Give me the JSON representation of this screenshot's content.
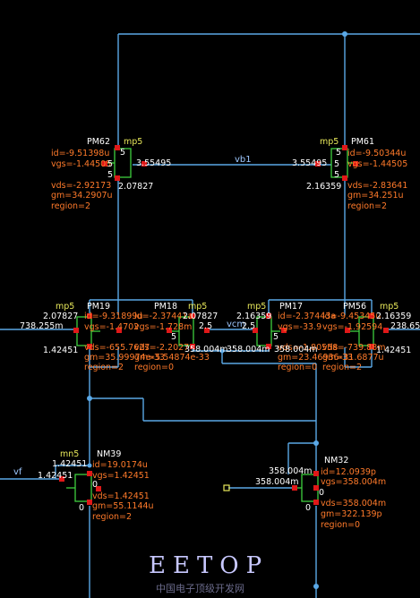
{
  "colors": {
    "background": "#000000",
    "wire": "#5aa8e6",
    "component": "#3ecf3e",
    "pin": "#e01818",
    "annotation": "#ff7a2a",
    "label": "#ffffff",
    "model": "#e8e85a"
  },
  "nets": {
    "vb1": "vb1",
    "vcm": "vcm",
    "vf": "vf"
  },
  "devices": [
    {
      "id": "PM62",
      "name": "PM62",
      "model": "mp5",
      "id_val": "id=-9.51398u",
      "vgs": "vgs=-1.44505",
      "vds": "vds=-2.92173",
      "gm": "gm=34.2907u",
      "region": "region=2",
      "pins": [
        "5",
        "5",
        "5",
        "3.55495",
        "2.07827"
      ]
    },
    {
      "id": "PM61",
      "name": "PM61",
      "model": "mp5",
      "id_val": "id=-9.50344u",
      "vgs": "vgs=-1.44505",
      "vds": "vds=-2.83641",
      "gm": "gm=34.251u",
      "region": "region=2",
      "pins": [
        "5",
        "5",
        "5",
        "3.55495",
        "2.16359"
      ]
    },
    {
      "id": "PM19",
      "name": "PM19",
      "model": "mp5",
      "id_val": "id=-9.31899u",
      "vgs": "vgs=-1.4702",
      "vds": "vds=-655.7627",
      "gm": "gm=35.99974e-33",
      "region": "region=2",
      "pins": [
        "2.07827",
        "1.42451",
        "738.255m"
      ]
    },
    {
      "id": "PM18",
      "name": "PM18",
      "model": "mp5",
      "id_val": "id=-2.37441a",
      "vgs": "vgs=-1.728m",
      "vds": "vds=-2.2027",
      "gm": "gm=5.54874e-33",
      "region": "region=0",
      "pins": [
        "2.07827",
        "2.5",
        "5",
        "358.004m",
        "358.004m"
      ]
    },
    {
      "id": "PM17",
      "name": "PM17",
      "model": "mp5",
      "id_val": "id=-2.37443a",
      "vgs": "vgs=-33.9",
      "vds": "vds=-1.80558",
      "gm": "gm=23.46936-33",
      "region": "region=0",
      "pins": [
        "2.16359",
        "2.5",
        "5",
        "358.004m"
      ]
    },
    {
      "id": "PM56",
      "name": "PM56",
      "model": "mp5",
      "id_val": "id=-9.45345u",
      "vgs": "vgs=-1.92594",
      "vds": "vds=-739.88m",
      "gm": "gm=31.6877u",
      "region": "region=2",
      "pins": [
        "2.16359",
        "1.42451",
        "238.65"
      ]
    },
    {
      "id": "NM39",
      "name": "NM39",
      "model": "mn5",
      "id_val": "id=19.0174u",
      "vgs": "vgs=1.42451",
      "vds": "vds=1.42451",
      "gm": "gm=55.1144u",
      "region": "region=2",
      "pins": [
        "1.42451",
        "1.42451",
        "0",
        "0"
      ]
    },
    {
      "id": "NM32",
      "name": "NM32",
      "model": "mn5",
      "id_val": "id=12.0939p",
      "vgs": "vgs=358.004m",
      "vds": "vds=358.004m",
      "gm": "gm=322.139p",
      "region": "region=0",
      "pins": [
        "358.004m",
        "358.004m",
        "0",
        "0"
      ]
    }
  ],
  "brand": {
    "title": "EETOP",
    "subtitle": "中国电子顶级开发网"
  }
}
